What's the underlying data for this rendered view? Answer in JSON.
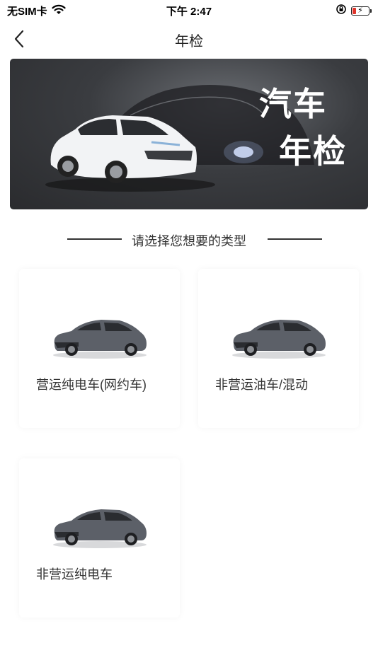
{
  "status_bar": {
    "carrier": "无SIM卡",
    "time": "下午 2:47",
    "battery_level": 0.2
  },
  "nav": {
    "title": "年检"
  },
  "banner": {
    "line1": "汽车",
    "line2": "年检"
  },
  "section": {
    "prompt": "请选择您想要的类型"
  },
  "cards": [
    {
      "label": "营运纯电车(网约车)"
    },
    {
      "label": "非营运油车/混动"
    },
    {
      "label": "非营运纯电车"
    }
  ],
  "colors": {
    "accent_red": "#e0352b",
    "card_car": "#5c6068"
  }
}
